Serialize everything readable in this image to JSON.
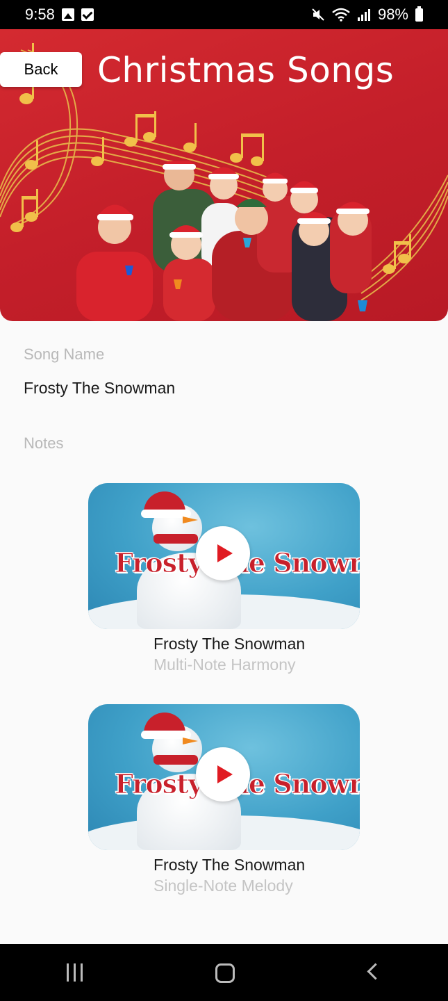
{
  "status_bar": {
    "time": "9:58",
    "battery": "98%",
    "icons": [
      "image-icon",
      "checkbox-icon",
      "mute-icon",
      "wifi-icon",
      "signal-icon",
      "battery-icon"
    ]
  },
  "header": {
    "back_label": "Back",
    "title": "Christmas Songs"
  },
  "song": {
    "name_label": "Song Name",
    "name_value": "Frosty The Snowman",
    "notes_label": "Notes"
  },
  "videos": [
    {
      "thumb_text": "Frosty The Snowman",
      "title": "Frosty The Snowman",
      "subtitle": "Multi-Note Harmony"
    },
    {
      "thumb_text": "Frosty The Snowman",
      "title": "Frosty The Snowman",
      "subtitle": "Single-Note Melody"
    }
  ],
  "colors": {
    "banner_red": "#c41f2a",
    "play_red": "#e01b22",
    "gold": "#f1c04a"
  },
  "nav_bar": {
    "icons": [
      "recents-icon",
      "home-icon",
      "back-icon"
    ]
  }
}
